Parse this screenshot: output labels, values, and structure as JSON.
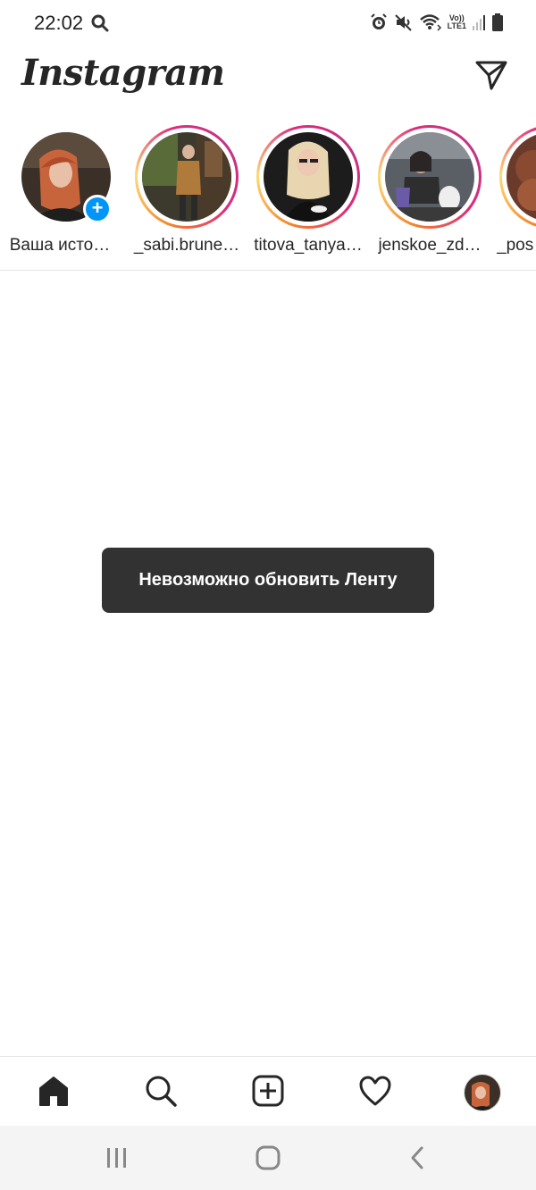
{
  "status_bar": {
    "time": "22:02",
    "icons": [
      "search-icon",
      "alarm-icon",
      "mute-icon",
      "wifi-icon",
      "volte-icon",
      "signal-icon",
      "battery-icon"
    ],
    "volte_top": "Vo))",
    "volte_bottom": "LTE1"
  },
  "header": {
    "logo": "Instagram",
    "direct_icon": "paper-plane-icon"
  },
  "stories": [
    {
      "label": "Ваша исто…",
      "own": true
    },
    {
      "label": "_sabi.brune…"
    },
    {
      "label": "titova_tanya…"
    },
    {
      "label": "jenskoe_zd…"
    },
    {
      "label": "_pos"
    }
  ],
  "toast": {
    "message": "Невозможно обновить Ленту"
  },
  "bottom_nav": {
    "items": [
      "home-icon",
      "search-icon",
      "new-post-icon",
      "heart-icon",
      "profile-avatar"
    ]
  },
  "system_nav": {
    "items": [
      "recent-apps-icon",
      "home-button-icon",
      "back-icon"
    ]
  },
  "colors": {
    "accent_blue": "#0095f6",
    "toast_bg": "#323232",
    "text": "#262626"
  }
}
